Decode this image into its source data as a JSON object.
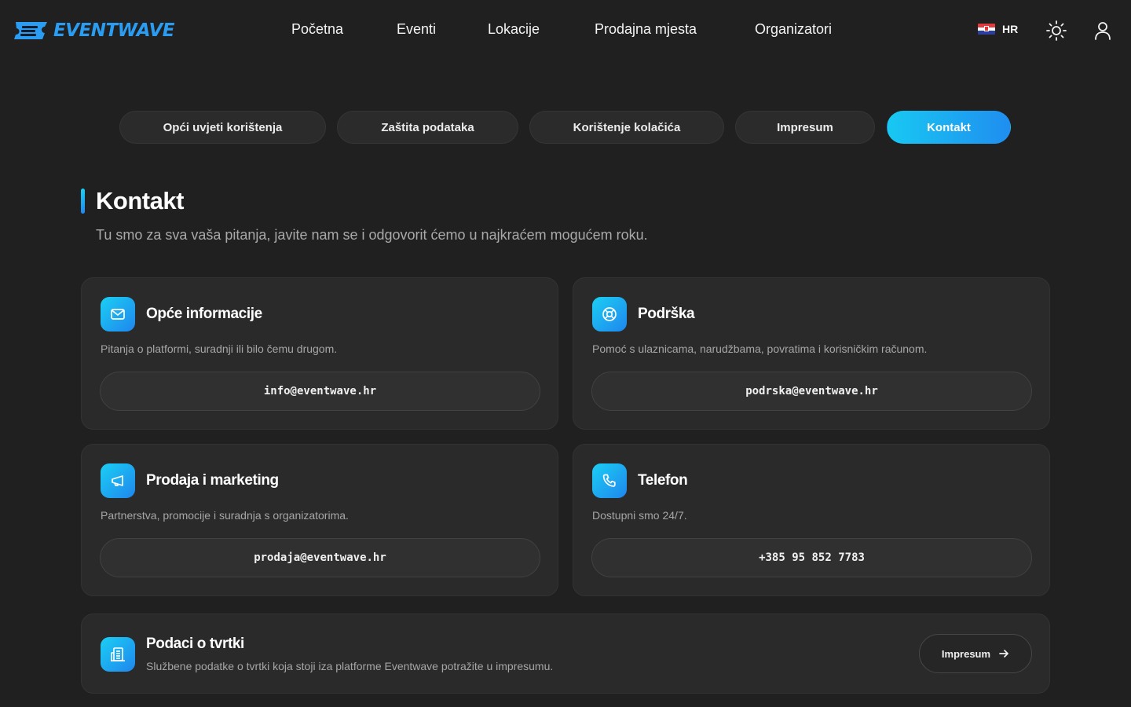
{
  "brand": {
    "name": "EVENTWAVE",
    "accent": "#2a9cf2",
    "gradient_start": "#1bcff3",
    "gradient_end": "#1f86ee"
  },
  "nav": {
    "items": [
      "Početna",
      "Eventi",
      "Lokacije",
      "Prodajna mjesta",
      "Organizatori"
    ],
    "language": "HR",
    "icons": [
      "croatia-flag-icon",
      "sun-icon",
      "user-icon"
    ]
  },
  "tabs": [
    {
      "label": "Opći uvjeti korištenja",
      "active": false
    },
    {
      "label": "Zaštita podataka",
      "active": false
    },
    {
      "label": "Korištenje kolačića",
      "active": false
    },
    {
      "label": "Impresum",
      "active": false
    },
    {
      "label": "Kontakt",
      "active": true
    }
  ],
  "page": {
    "title": "Kontakt",
    "subtitle": "Tu smo za sva vaša pitanja, javite nam se i odgovorit ćemo u najkraćem mogućem roku."
  },
  "contacts": [
    {
      "icon": "mail-icon",
      "title": "Opće informacije",
      "description": "Pitanja o platformi, suradnji ili bilo čemu drugom.",
      "value": "info@eventwave.hr"
    },
    {
      "icon": "lifebuoy-icon",
      "title": "Podrška",
      "description": "Pomoć s ulaznicama, narudžbama, povratima i korisničkim računom.",
      "value": "podrska@eventwave.hr"
    },
    {
      "icon": "megaphone-icon",
      "title": "Prodaja i marketing",
      "description": "Partnerstva, promocije i suradnja s organizatorima.",
      "value": "prodaja@eventwave.hr"
    },
    {
      "icon": "phone-icon",
      "title": "Telefon",
      "description": "Dostupni smo 24/7.",
      "value": "+385 95 852 7783"
    }
  ],
  "company": {
    "icon": "building-icon",
    "title": "Podaci o tvrtki",
    "description": "Službene podatke o tvrtki koja stoji iza platforme Eventwave potražite u impresumu.",
    "button_label": "Impresum",
    "button_icon": "arrow-right-icon"
  }
}
